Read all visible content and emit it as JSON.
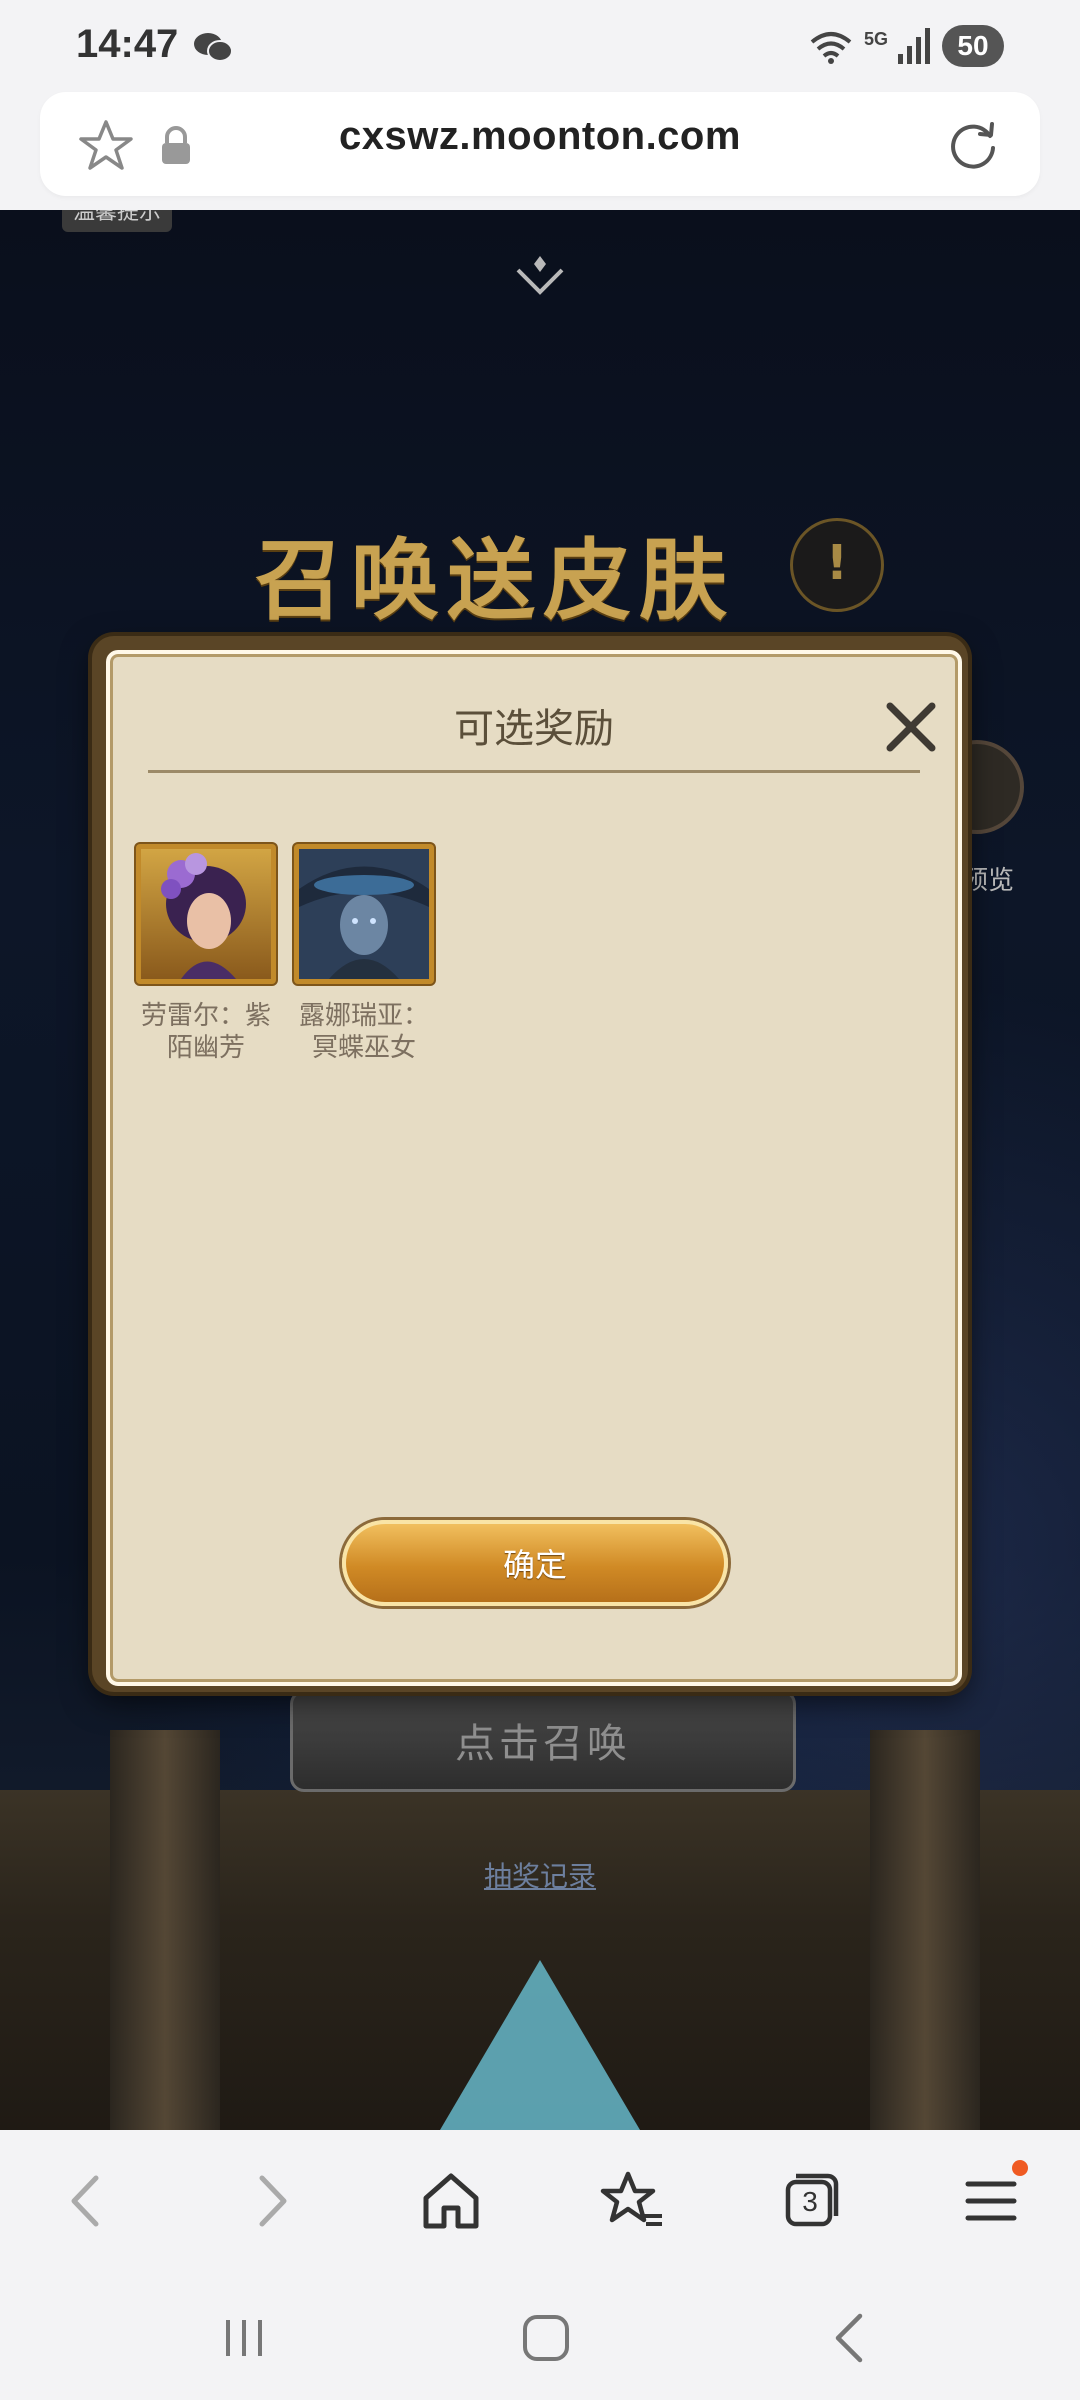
{
  "status_bar": {
    "time": "14:47",
    "network": "5G",
    "battery": "50"
  },
  "browser": {
    "url": "cxswz.moonton.com",
    "tab_count": "3"
  },
  "game": {
    "top_tag": "温馨提示",
    "title": "召唤送皮肤",
    "info_symbol": "!",
    "preview_label": "预览",
    "summon_button": "点击召唤",
    "history_link": "抽奖记录"
  },
  "modal": {
    "title": "可选奖励",
    "rewards": [
      {
        "name_line1": "劳雷尔：紫",
        "name_line2": "陌幽芳"
      },
      {
        "name_line1": "露娜瑞亚：",
        "name_line2": "冥蝶巫女"
      }
    ],
    "confirm_label": "确定"
  },
  "colors": {
    "accent_gold": "#d08a25",
    "modal_bg": "#e6dcc4",
    "title_gold": "#c8a251",
    "notification_dot": "#ef5a22"
  }
}
